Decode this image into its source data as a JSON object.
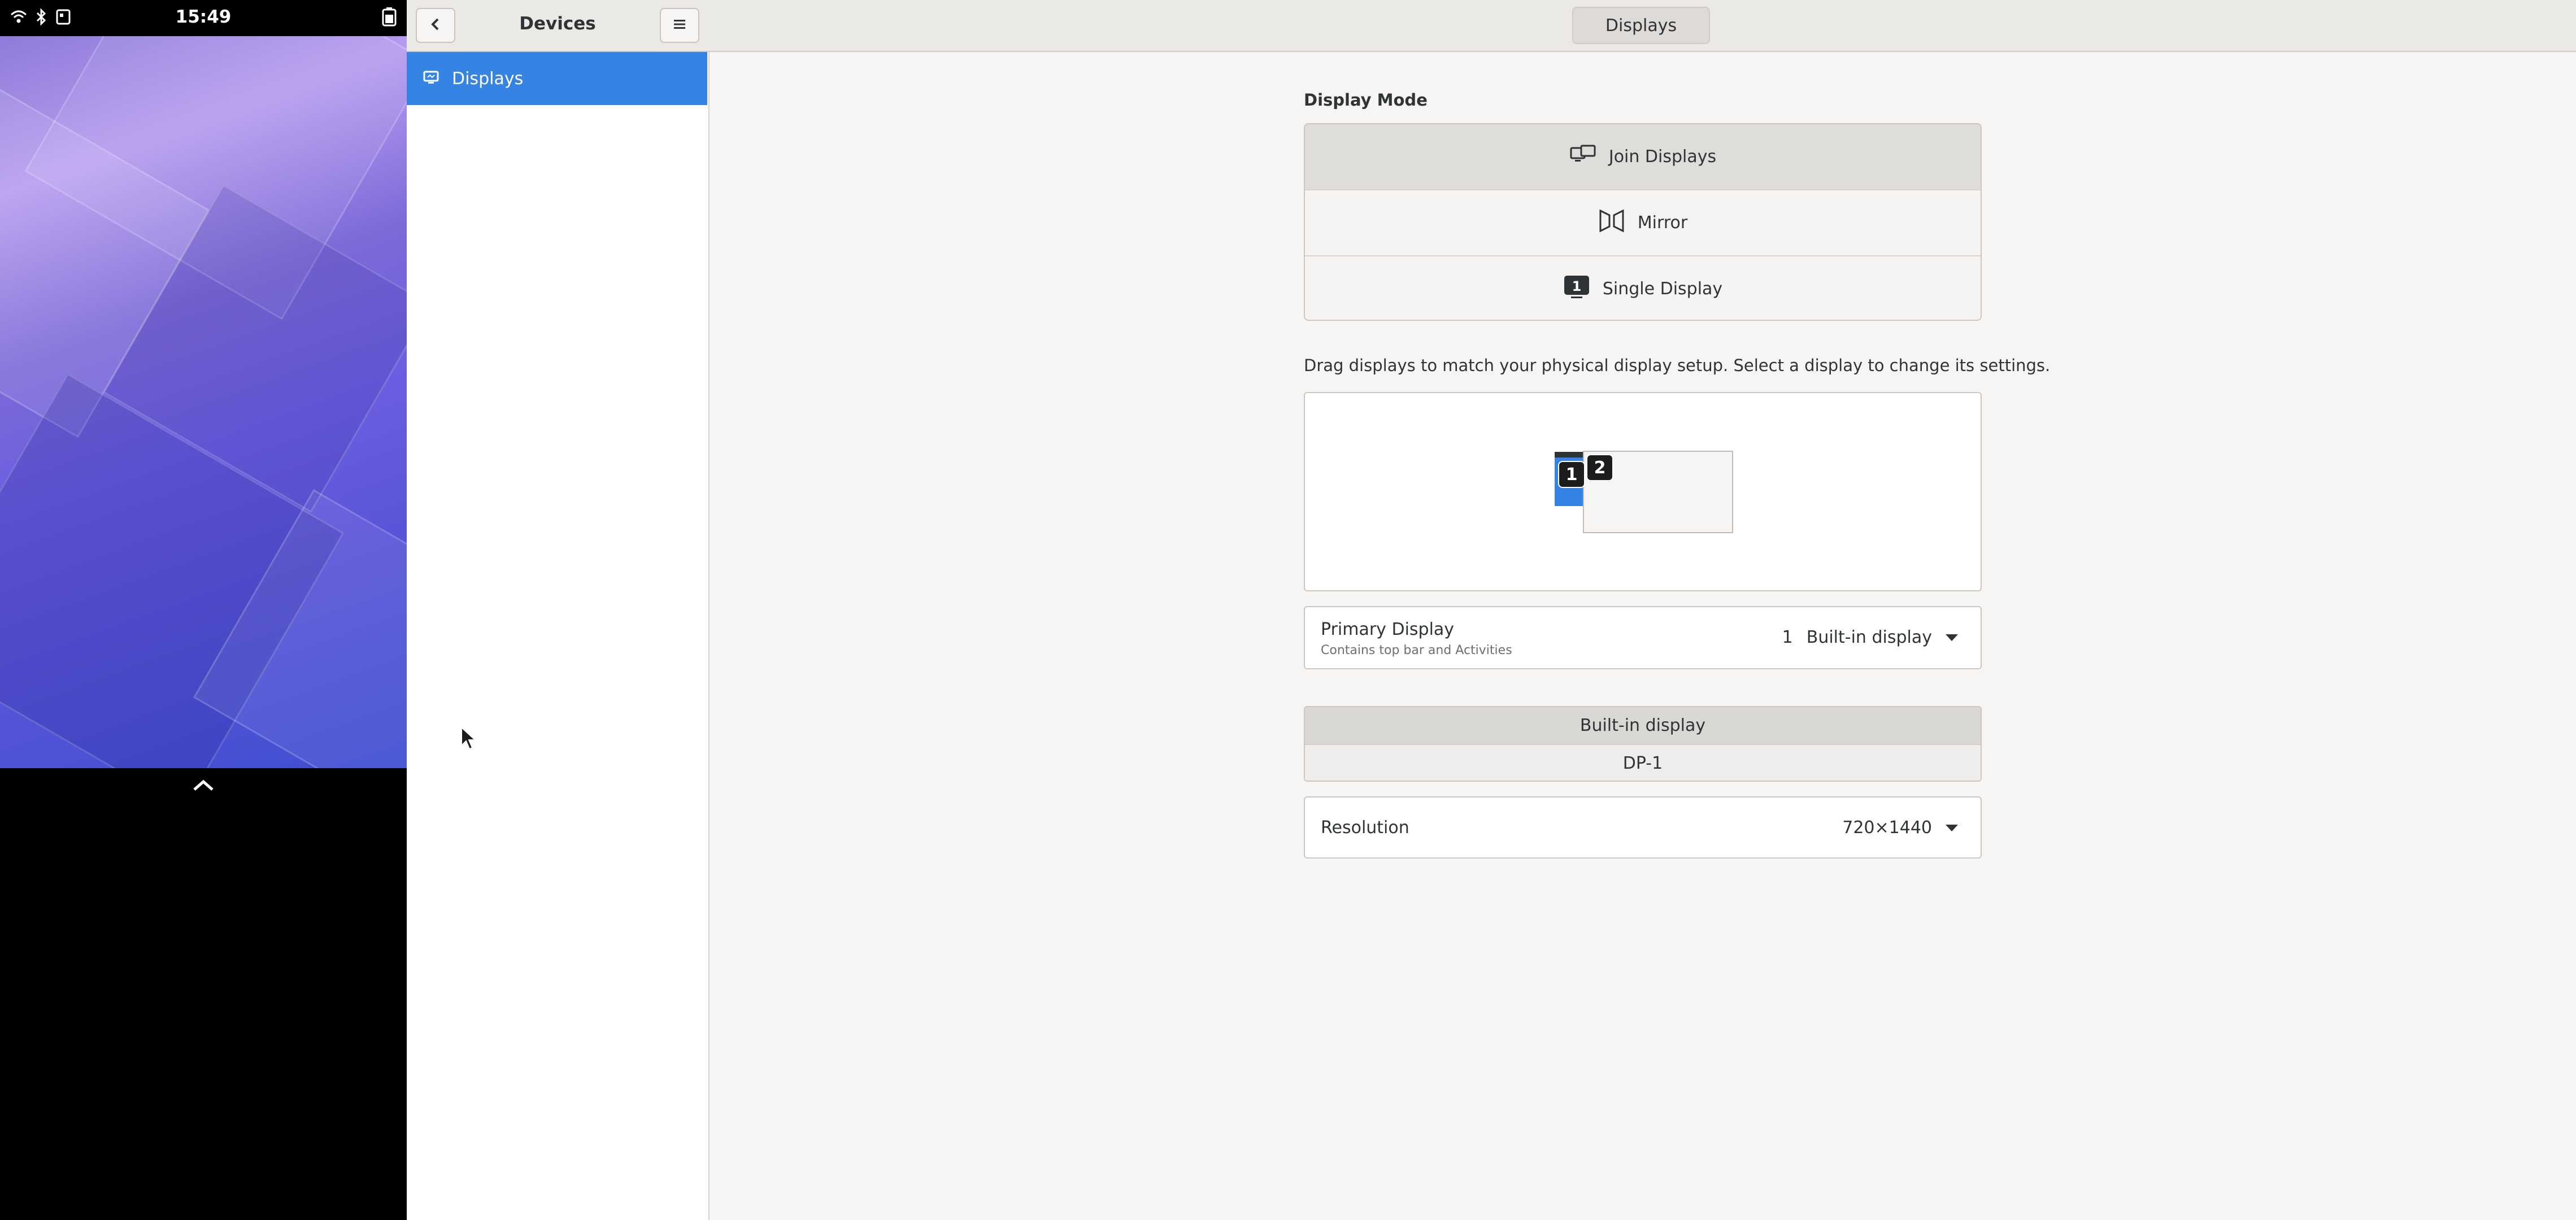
{
  "statusbar": {
    "time": "15:49",
    "icons": [
      "wifi-icon",
      "bluetooth-icon",
      "phone-icon",
      "battery-icon"
    ]
  },
  "sidebar": {
    "title": "Devices",
    "back_icon": "back-arrow-icon",
    "menu_icon": "hamburger-menu-icon",
    "items": [
      {
        "label": "Displays",
        "icon": "display-icon",
        "selected": true
      }
    ]
  },
  "header": {
    "title": "Displays"
  },
  "display_mode": {
    "label": "Display Mode",
    "options": [
      {
        "label": "Join Displays",
        "icon": "join-displays-icon",
        "active": true
      },
      {
        "label": "Mirror",
        "icon": "mirror-icon",
        "active": false
      },
      {
        "label": "Single Display",
        "icon": "single-display-icon",
        "active": false
      }
    ]
  },
  "arrangement": {
    "hint": "Drag displays to match your physical display setup. Select a display to change its settings.",
    "monitors": [
      {
        "number": "1",
        "selected": true
      },
      {
        "number": "2",
        "selected": false
      }
    ]
  },
  "primary_display": {
    "title": "Primary Display",
    "subtitle": "Contains top bar and Activities",
    "number": "1",
    "value": "Built-in display"
  },
  "display_tabs": [
    {
      "label": "Built-in display",
      "selected": true
    },
    {
      "label": "DP-1",
      "selected": false
    }
  ],
  "resolution": {
    "label": "Resolution",
    "value": "720×1440"
  },
  "colors": {
    "accent": "#3584e4",
    "header_bg": "#ebe9e6",
    "window_bg": "#f6f5f4"
  }
}
